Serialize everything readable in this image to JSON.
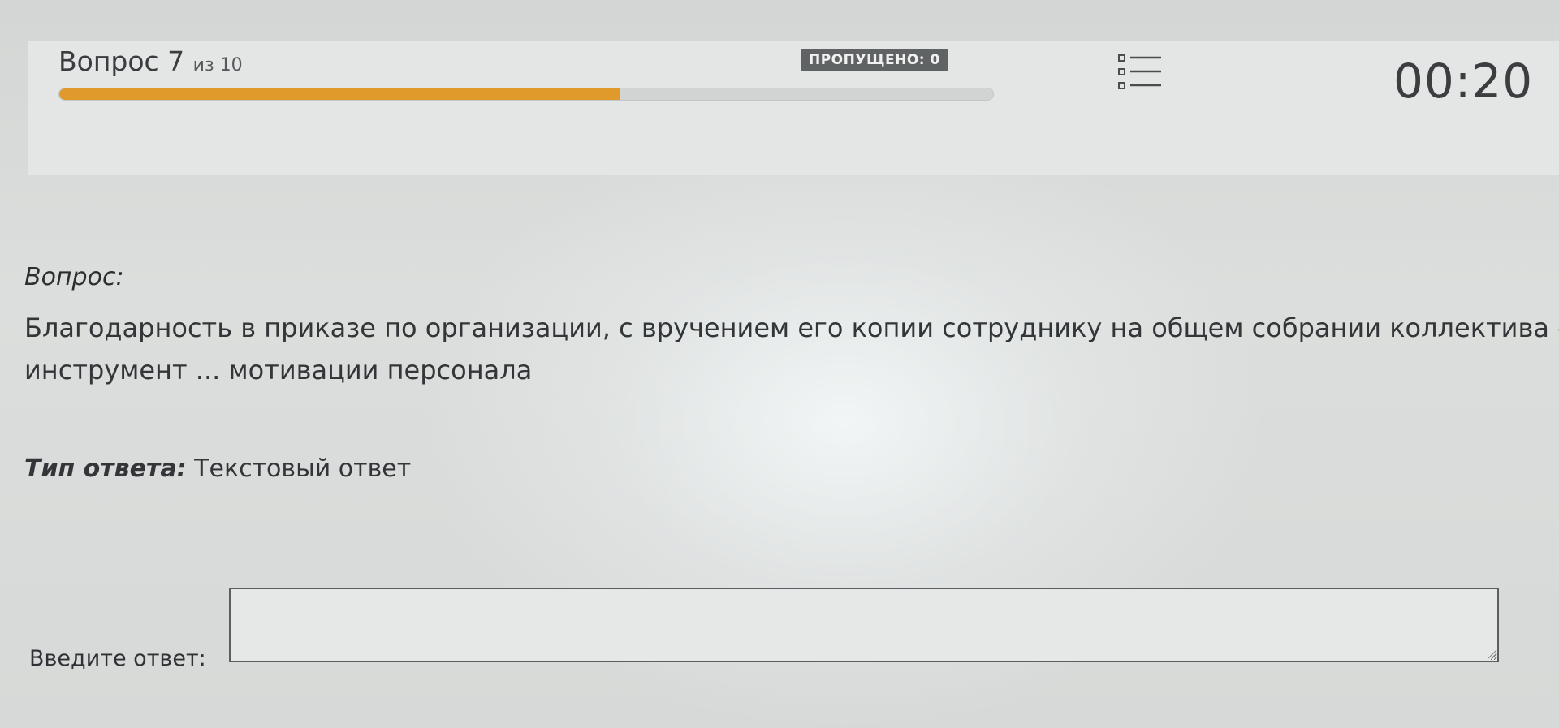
{
  "header": {
    "question_word": "Вопрос 7",
    "question_of": "из 10",
    "progress": 0.6,
    "skipped_label": "ПРОПУЩЕНО: 0",
    "list_icon": "list-icon",
    "timer": "00:20"
  },
  "question": {
    "label": "Вопрос:",
    "text_line1": "Благодарность в приказе по организации, с вручением его копии сотруднику на общем собрании коллектива –",
    "text_line2": "инструмент ... мотивации персонала"
  },
  "answer_type": {
    "label": "Тип ответа:",
    "value": "Текстовый ответ"
  },
  "answer": {
    "label": "Введите ответ:",
    "value": "",
    "placeholder": ""
  },
  "colors": {
    "progress_fill": "#e09a2c",
    "badge_bg": "#5f6364"
  }
}
